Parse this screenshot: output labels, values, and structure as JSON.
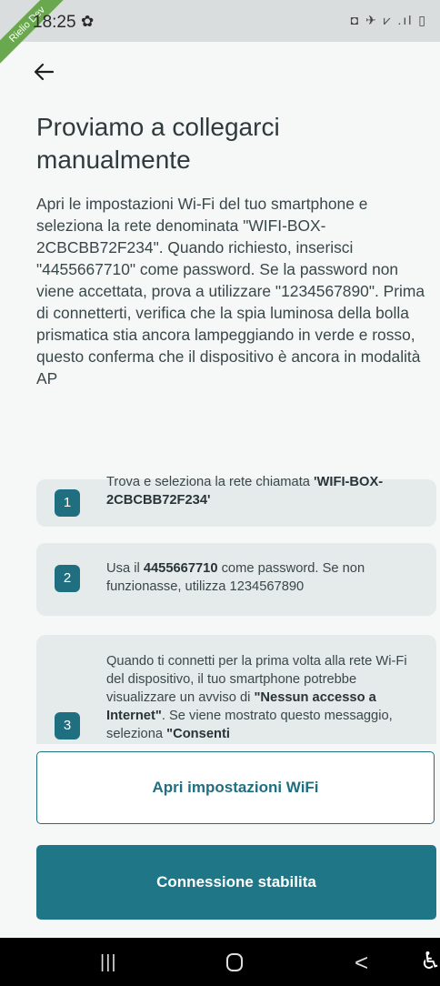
{
  "status_bar": {
    "time": "18:25",
    "icons": "◘ ✈ ⩗ .ıl ▯",
    "ribbon": "Rielio Dev"
  },
  "header": {
    "title": "Proviamo a collegarci manualmente"
  },
  "description": "Apri le impostazioni Wi-Fi del tuo smartphone e seleziona la rete denominata \"WIFI-BOX-2CBCBB72F234\". Quando richiesto, inserisci \"4455667710\" come password. Se la password non viene accettata, prova a utilizzare \"1234567890\". Prima di connetterti, verifica che la spia luminosa della bolla prismatica stia ancora lampeggiando in verde e rosso, questo conferma che il dispositivo è ancora in modalità AP",
  "steps": [
    {
      "number": "1",
      "text_1": "Trova e seleziona la rete chiamata ",
      "bold_1": "'WIFI-BOX-2CBCBB72F234'"
    },
    {
      "number": "2",
      "text_1": "Usa il ",
      "bold_1": "4455667710",
      "text_2": " come password. Se non funzionasse, utilizza 1234567890"
    },
    {
      "number": "3",
      "text_1": "Quando ti connetti per la prima volta alla rete Wi-Fi del dispositivo, il tuo smartphone potrebbe visualizzare un avviso di ",
      "bold_1": "\"Nessun accesso a Internet\"",
      "text_2": ". Se viene mostrato questo messaggio, seleziona ",
      "bold_2": "\"Consenti"
    }
  ],
  "buttons": {
    "open_wifi": "Apri impostazioni WiFi",
    "connected": "Connessione stabilita"
  },
  "nav": {
    "recent": "|||",
    "back": "<",
    "accessibility": "🯅"
  },
  "colors": {
    "accent": "#1f6f80",
    "primary_button": "#1f7686",
    "card_bg": "#e5eaeb",
    "background": "#f6f8f8"
  }
}
